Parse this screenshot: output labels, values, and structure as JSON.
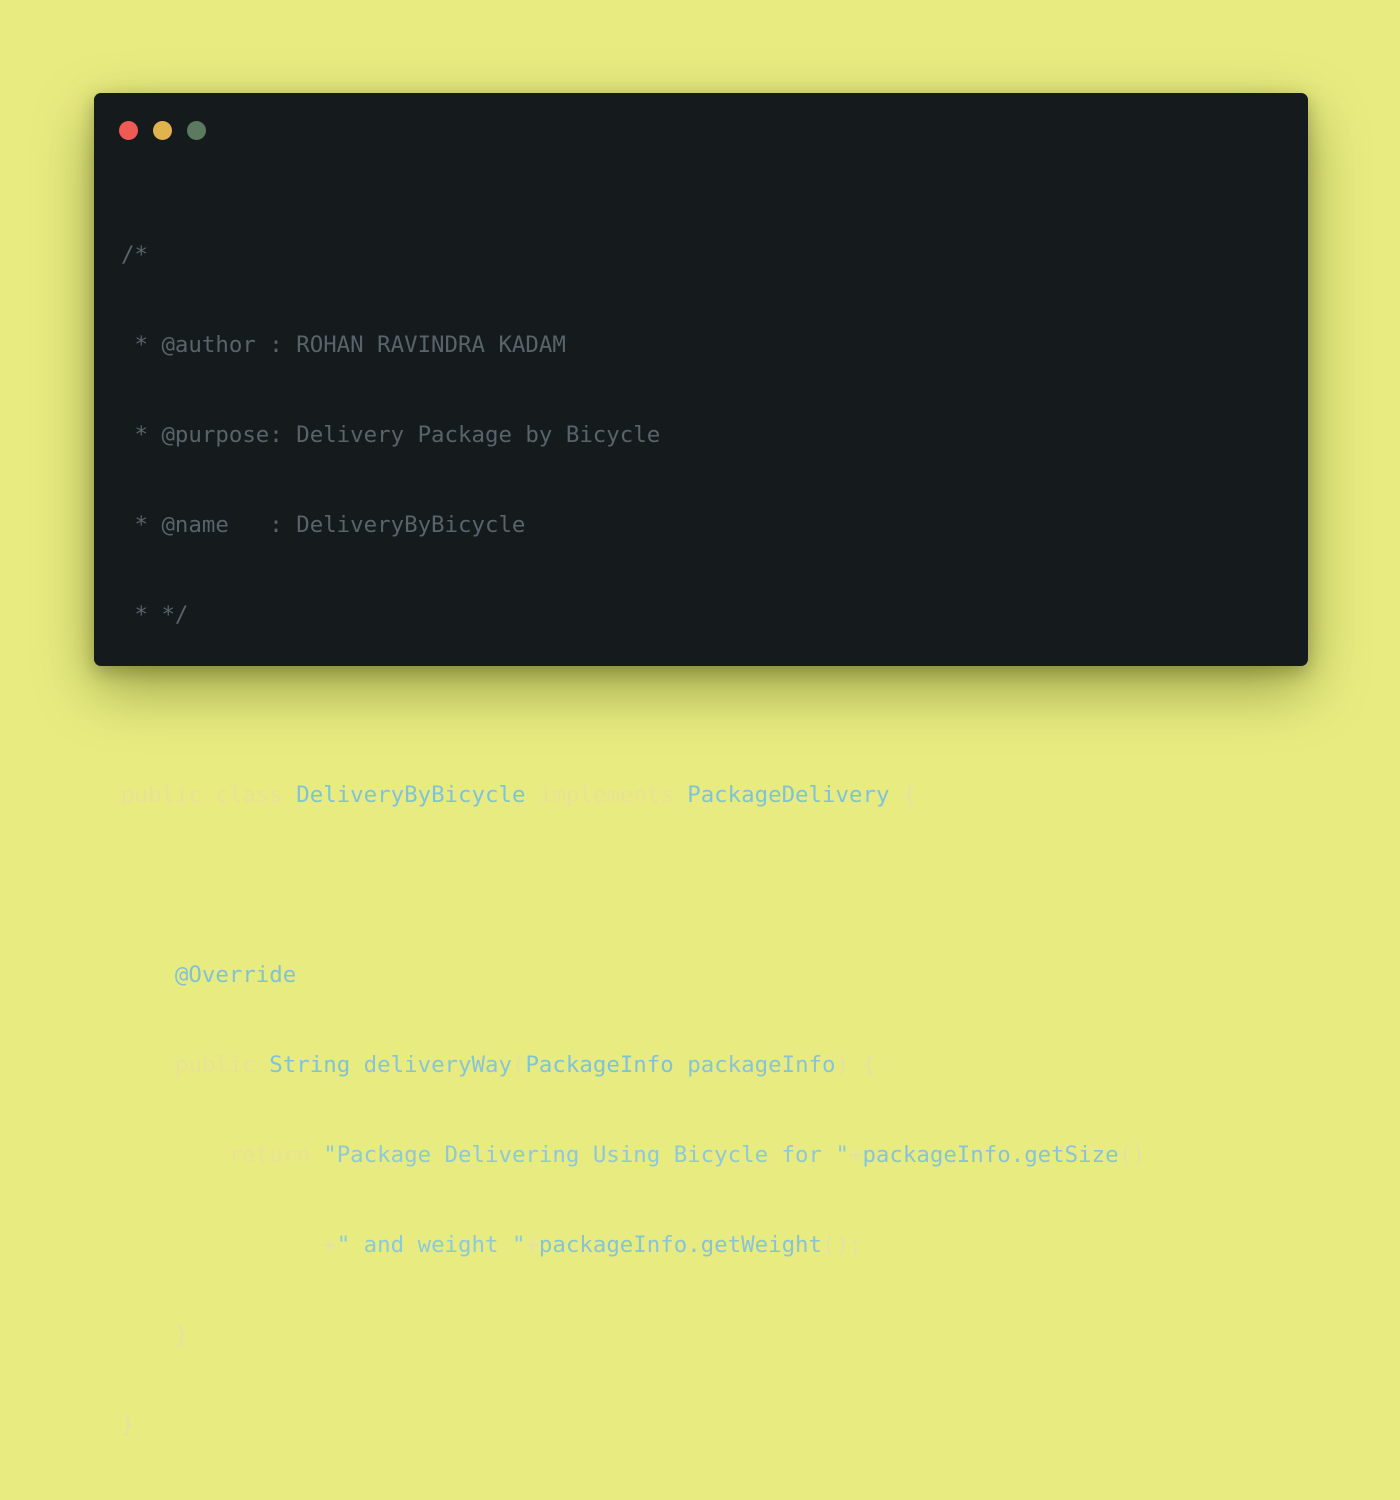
{
  "window": {
    "traffic_lights": [
      {
        "name": "close",
        "color": "#ee5b55"
      },
      {
        "name": "minimize",
        "color": "#e1b34f"
      },
      {
        "name": "maximize",
        "color": "#5c7a5f"
      }
    ]
  },
  "code": {
    "language": "java",
    "comment": {
      "open": "/*",
      "author": " * @author : ROHAN RAVINDRA KADAM",
      "purpose": " * @purpose: Delivery Package by Bicycle",
      "name": " * @name   : DeliveryByBicycle",
      "close": " * */"
    },
    "class_decl": {
      "kw_public": "public",
      "kw_class": "class",
      "class_name": "DeliveryByBicycle",
      "kw_implements": "implements",
      "interface_name": "PackageDelivery",
      "brace": "{"
    },
    "annotation": "@Override",
    "method_decl": {
      "kw_public": "public",
      "return_type": "String",
      "method_name": "deliveryWay",
      "open_paren": "(",
      "param_type": "PackageInfo",
      "param_name": "packageInfo",
      "close_paren_brace": ") {"
    },
    "return_line": {
      "kw_return": "return",
      "string1": "\"Package Delivering Using Bicycle for \"",
      "plus1": "+",
      "call1": "packageInfo.getSize",
      "parens1": "()"
    },
    "continuation_line": {
      "plus": "+",
      "string2": "\" and weight \"",
      "plus2": "+",
      "call2": "packageInfo.getWeight",
      "parens2": "();"
    },
    "method_close": "}",
    "class_close": "}"
  }
}
